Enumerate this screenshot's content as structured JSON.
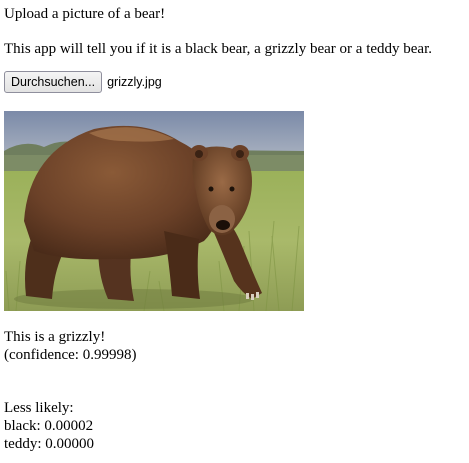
{
  "header": {
    "title": "Upload a picture of a bear!",
    "description": "This app will tell you if it is a black bear, a grizzly bear or a teddy bear."
  },
  "upload": {
    "button_label": "Durchsuchen...",
    "file_name": "grizzly.jpg"
  },
  "image": {
    "alt": "grizzly bear walking through grass"
  },
  "result": {
    "prediction_text": "This is a grizzly!",
    "confidence_text": "(confidence: 0.99998)",
    "less_likely_heading": "Less likely:",
    "alternatives": [
      {
        "text": "black: 0.00002"
      },
      {
        "text": "teddy: 0.00000"
      }
    ]
  }
}
